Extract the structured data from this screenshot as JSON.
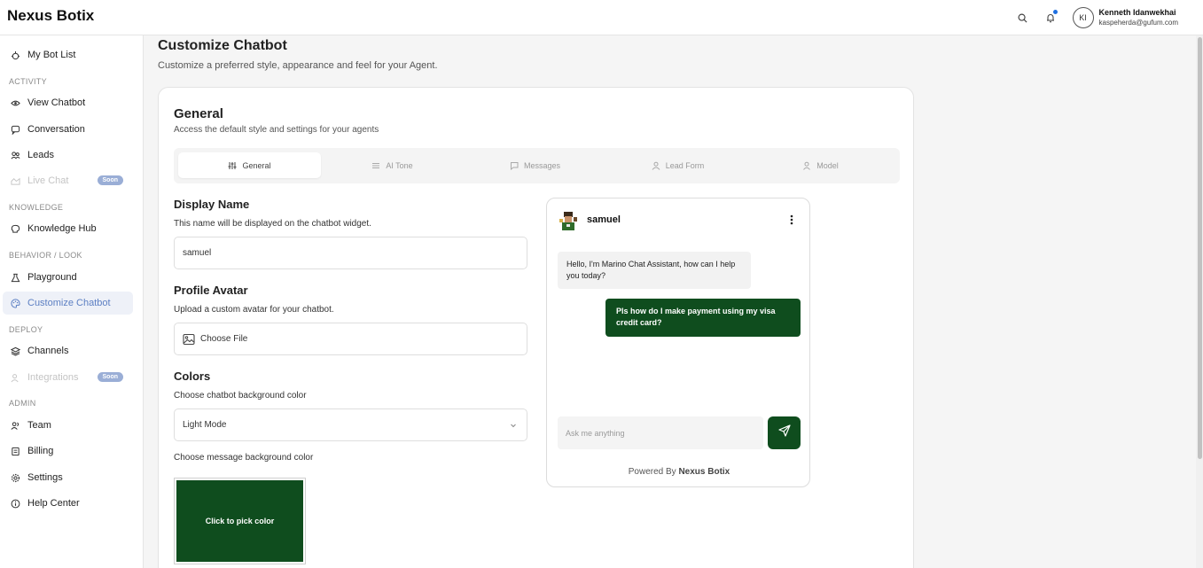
{
  "brand": "Nexus Botix",
  "header": {
    "avatar_initials": "KI",
    "user_name": "Kenneth Idanwekhai",
    "user_email": "kaspeherda@gufum.com"
  },
  "sidebar": {
    "top_item": {
      "label": "My Bot List",
      "icon": "bot-icon"
    },
    "sections": {
      "activity": "ACTIVITY",
      "knowledge": "KNOWLEDGE",
      "behavior": "BEHAVIOR / LOOK",
      "deploy": "DEPLOY",
      "admin": "ADMIN"
    },
    "items": {
      "view_chatbot": "View Chatbot",
      "conversation": "Conversation",
      "leads": "Leads",
      "live_chat": "Live Chat",
      "knowledge_hub": "Knowledge Hub",
      "playground": "Playground",
      "customize_chatbot": "Customize Chatbot",
      "channels": "Channels",
      "integrations": "Integrations",
      "team": "Team",
      "billing": "Billing",
      "settings": "Settings",
      "help_center": "Help Center"
    },
    "soon_badge": "Soon"
  },
  "page": {
    "title": "Customize Chatbot",
    "subtitle": "Customize a preferred style, appearance and feel for your Agent."
  },
  "card": {
    "title": "General",
    "subtitle": "Access the default style and settings for your agents",
    "tabs": [
      "General",
      "AI Tone",
      "Messages",
      "Lead Form",
      "Model"
    ],
    "display_name": {
      "title": "Display Name",
      "desc": "This name will be displayed on the chatbot widget.",
      "value": "samuel"
    },
    "profile_avatar": {
      "title": "Profile Avatar",
      "desc": "Upload a custom avatar for your chatbot.",
      "button": "Choose File"
    },
    "colors": {
      "title": "Colors",
      "bg_desc": "Choose chatbot background color",
      "bg_value": "Light Mode",
      "msg_desc": "Choose message background color",
      "pick_label": "Click to pick color",
      "message_color": "#0f4d1e"
    }
  },
  "preview": {
    "bot_name": "samuel",
    "bot_message": "Hello, I'm Marino Chat Assistant, how can I help you today?",
    "user_message": "Pls how do I make payment using my visa credit card?",
    "input_placeholder": "Ask me anything",
    "footer_prefix": "Powered By",
    "footer_brand": "Nexus Botix"
  },
  "colors": {
    "accent_green": "#0f4d1e",
    "active_nav": "#5c7fc3",
    "notification_dot": "#1e6fe0"
  }
}
